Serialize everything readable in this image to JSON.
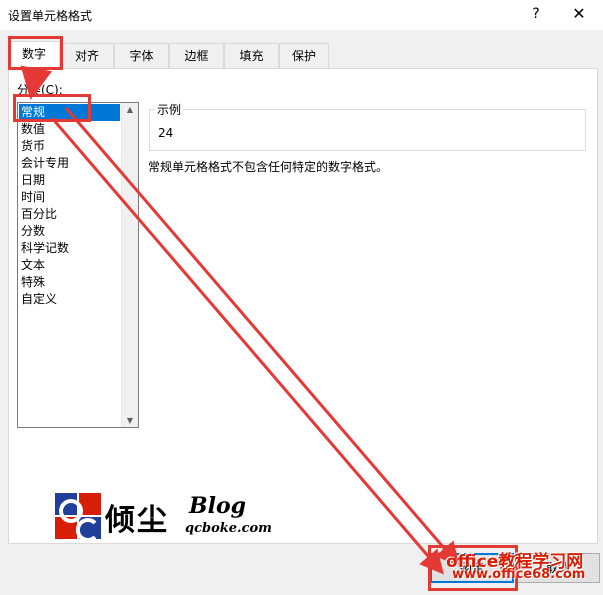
{
  "window": {
    "title": "设置单元格格式",
    "help_glyph": "?",
    "close_glyph": "✕"
  },
  "tabs": [
    {
      "label": "数字",
      "active": true
    },
    {
      "label": "对齐"
    },
    {
      "label": "字体"
    },
    {
      "label": "边框"
    },
    {
      "label": "填充"
    },
    {
      "label": "保护"
    }
  ],
  "category": {
    "label": "分类(C):",
    "items": [
      "常规",
      "数值",
      "货币",
      "会计专用",
      "日期",
      "时间",
      "百分比",
      "分数",
      "科学记数",
      "文本",
      "特殊",
      "自定义"
    ],
    "selected": "常规"
  },
  "sample": {
    "legend": "示例",
    "value": "24"
  },
  "description": "常规单元格格式不包含任何特定的数字格式。",
  "buttons": {
    "ok": "确定",
    "cancel": "取消"
  },
  "logo": {
    "cn_text": "倾尘",
    "blog_text": "Blog",
    "domain_text": "qcboke.com"
  },
  "watermark": {
    "text": "office教程学习网",
    "url": "www.office68.com"
  },
  "colors": {
    "selection": "#0078d7",
    "annotation": "#e53935",
    "watermark": "#d81e06"
  }
}
